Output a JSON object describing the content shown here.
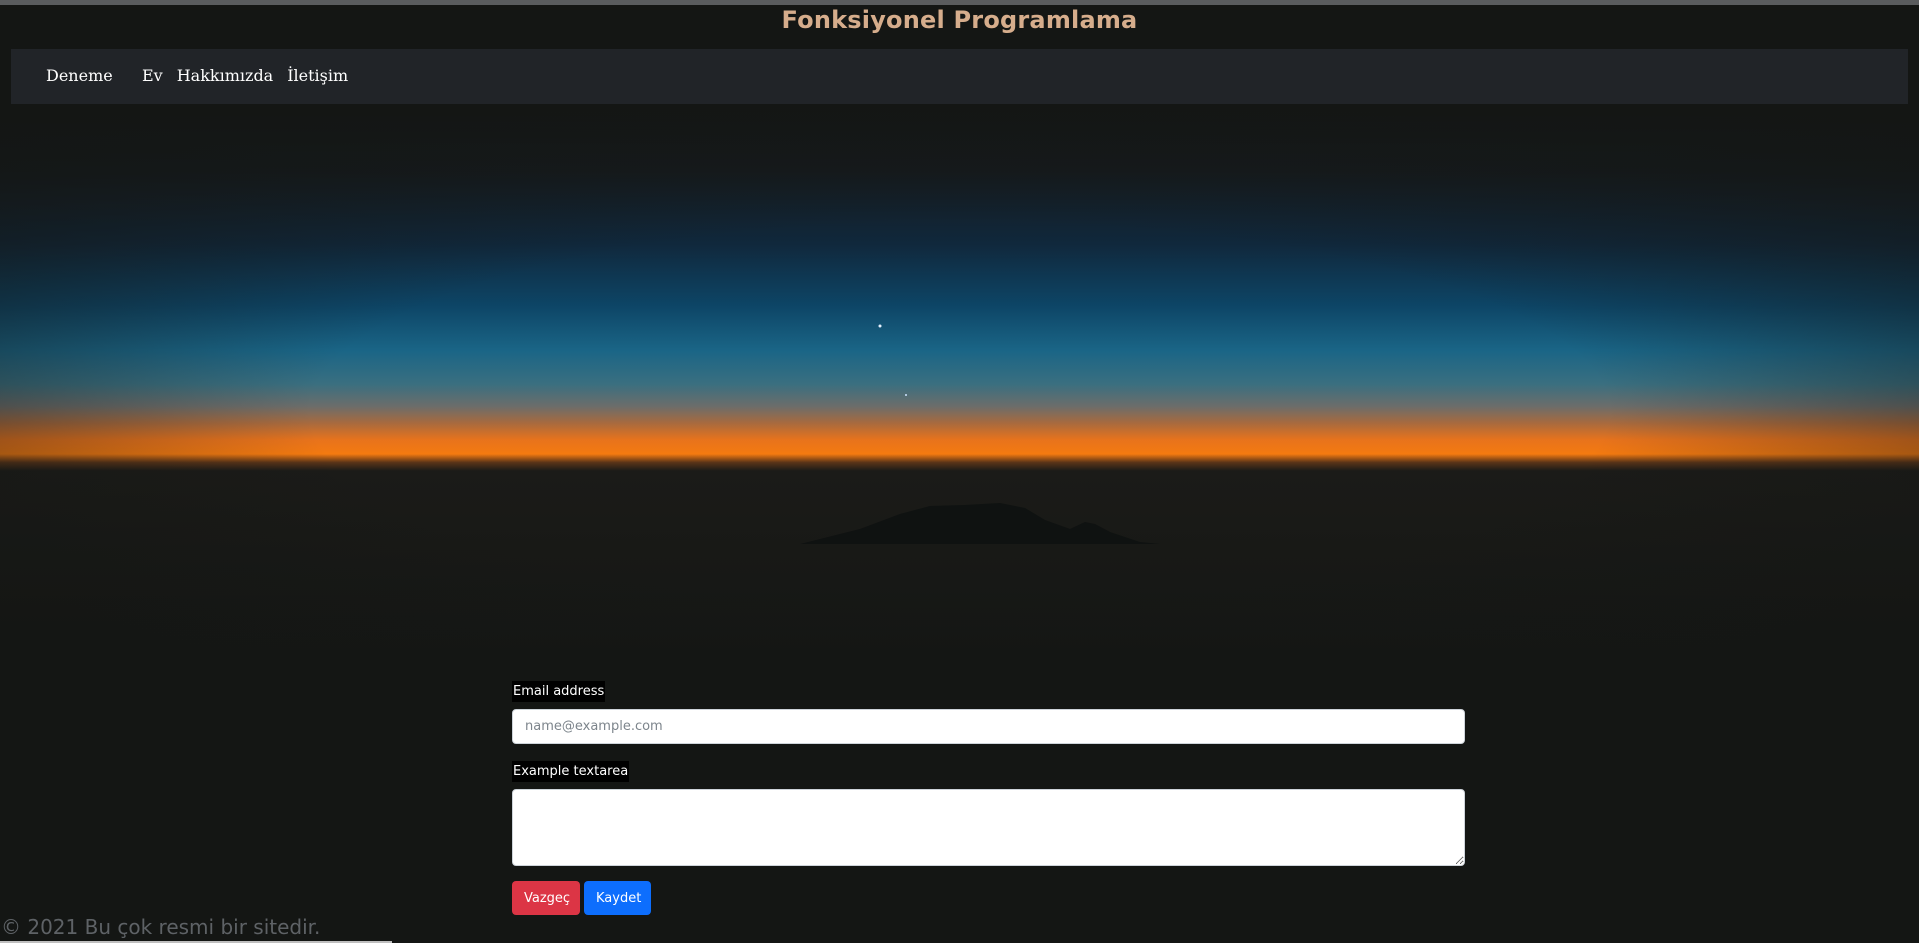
{
  "header": {
    "site_title": "Fonksiyonel Programlama"
  },
  "navbar": {
    "brand": "Deneme",
    "links": [
      "Ev",
      "Hakkımızda",
      "İletişim"
    ]
  },
  "form": {
    "email_label": "Email address",
    "email_placeholder": "name@example.com",
    "email_value": "",
    "textarea_label": "Example textarea",
    "textarea_value": "",
    "cancel_button": "Vazgeç",
    "save_button": "Kaydet"
  },
  "footer": {
    "copyright": "© 2021 Bu çok resmi bir sitedir."
  },
  "colors": {
    "title": "#d6ad8c",
    "navbar_bg": "#212428",
    "cancel": "#dc3545",
    "save": "#0d6efd"
  }
}
